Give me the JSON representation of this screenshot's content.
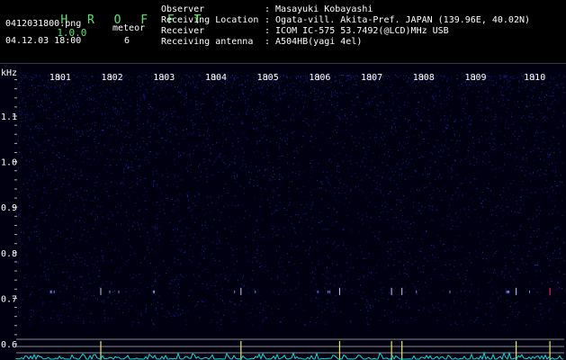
{
  "header": {
    "app_name": "H R O F F T",
    "version": "1.0.0",
    "filename": "0412031800.png",
    "meteor_label": "meteor",
    "meteor_count": "6",
    "datetime": "04.12.03 18:00",
    "info": [
      {
        "key": "Observer",
        "value": ": Masayuki Kobayashi"
      },
      {
        "key": "Receiving Location",
        "value": ": Ogata-vill. Akita-Pref. JAPAN (139.96E, 40.02N)"
      },
      {
        "key": "Receiver",
        "value": ": ICOM IC-575 53.7492(@LCD)MHz USB"
      },
      {
        "key": "Receiving antenna",
        "value": ": A504HB(yagi 4el)"
      }
    ]
  },
  "colors": {
    "text_green": "#5ee36b",
    "noise_blue": "#2a2ad0",
    "trace_cyan": "#00e0e0",
    "echo_yellow": "#e8e860",
    "echo_red": "#ff3060"
  },
  "chart_data": {
    "type": "heatmap",
    "ylabel": "kHz",
    "time_ticks": [
      "1801",
      "1802",
      "1803",
      "1804",
      "1805",
      "1806",
      "1807",
      "1808",
      "1809",
      "1810"
    ],
    "freq_ticks": [
      "1.1",
      "1.0",
      "0.9",
      "0.8",
      "0.7",
      "0.6"
    ],
    "freq_values": [
      1.1,
      1.0,
      0.9,
      0.8,
      0.7,
      0.6
    ],
    "ylim": [
      0.58,
      1.18
    ],
    "time_range_min": [
      0,
      10
    ],
    "meteor_echoes_min": [
      1.3,
      4.0,
      5.9,
      6.9,
      7.1,
      9.3,
      9.95
    ],
    "echo_freq_khz": 0.715
  }
}
